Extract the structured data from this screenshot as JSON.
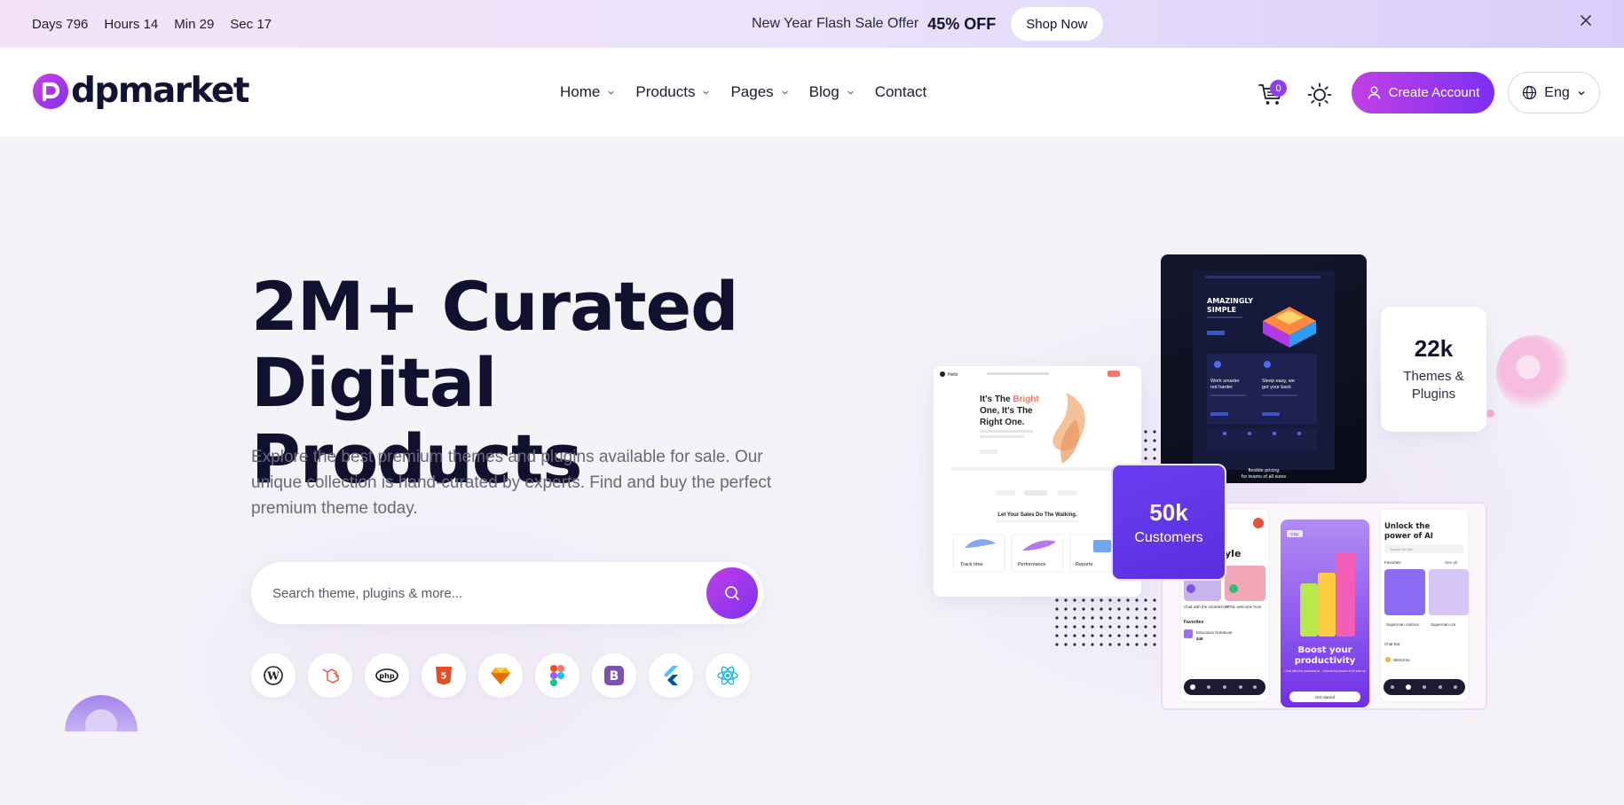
{
  "promo": {
    "countdown": [
      {
        "label": "Days",
        "value": "796"
      },
      {
        "label": "Hours",
        "value": "14"
      },
      {
        "label": "Min",
        "value": "29"
      },
      {
        "label": "Sec",
        "value": "17"
      }
    ],
    "text": "New Year Flash Sale Offer",
    "discount": "45% OFF",
    "cta": "Shop Now",
    "close_icon": "close-icon"
  },
  "header": {
    "logo_text": "dpmarket",
    "nav": [
      {
        "label": "Home",
        "has_dropdown": true
      },
      {
        "label": "Products",
        "has_dropdown": true
      },
      {
        "label": "Pages",
        "has_dropdown": true
      },
      {
        "label": "Blog",
        "has_dropdown": true
      },
      {
        "label": "Contact",
        "has_dropdown": false
      }
    ],
    "cart_count": "0",
    "create_account": "Create Account",
    "language": "Eng",
    "accent_start": "#c240e6",
    "accent_end": "#7b30f3"
  },
  "hero": {
    "title_line1": "2M+ Curated",
    "title_line2": "Digital Products",
    "description": "Explore the best premium themes and plugins available for sale. Our unique collection is hand-curated by experts. Find and buy the perfect premium theme today.",
    "search_placeholder": "Search theme, plugins & more...",
    "tech_icons": [
      "wordpress-icon",
      "laravel-icon",
      "php-icon",
      "html5-icon",
      "sketch-icon",
      "figma-icon",
      "bootstrap-icon",
      "flutter-icon",
      "react-icon"
    ]
  },
  "stats": {
    "themes": {
      "value": "22k",
      "label_line1": "Themes &",
      "label_line2": "Plugins"
    },
    "customers": {
      "value": "50k",
      "label": "Customers"
    }
  },
  "mockups": {
    "dark": {
      "headline_1": "AMAZINGLY",
      "headline_2": "SIMPLE",
      "card1_1": "Work smarter",
      "card1_2": "not harder",
      "card2_1": "Sleep easy, we",
      "card2_2": "got your back",
      "footer_1": "flexible pricing",
      "footer_2": "for teams of all sizes"
    },
    "left": {
      "logo": "Hello",
      "headline_1": "It's The ",
      "headline_bright": "Bright",
      "headline_2": "One, It's The",
      "headline_3": "Right One.",
      "subhead": "Let Your Sales Do The Walking.",
      "features": [
        "Track time",
        "Performance",
        "Reports"
      ]
    },
    "bottom": {
      "app1_title": "yle",
      "app1_items": [
        "Chat with the smartest AI",
        "HTML welcome from"
      ],
      "app1_fav": "Favorites",
      "app1_fav_item": "Education Notebook",
      "app1_price": "$48",
      "app2_badge": "Chip",
      "app2_title_1": "Boost your",
      "app2_title_2": "productivity",
      "app2_sub": "Chat with the smartest AI - Unlock the power of AI with us",
      "app2_cta": "Get started",
      "app3_title_1": "Unlock the",
      "app3_title_2": "power of AI",
      "app3_search": "Search for title",
      "app3_fav": "Favorites",
      "app3_see": "See all",
      "app3_card1": "Superman cartoon",
      "app3_card2": "Superman car",
      "app3_chat": "Chat Bot",
      "app3_welcome": "Welcome"
    }
  }
}
